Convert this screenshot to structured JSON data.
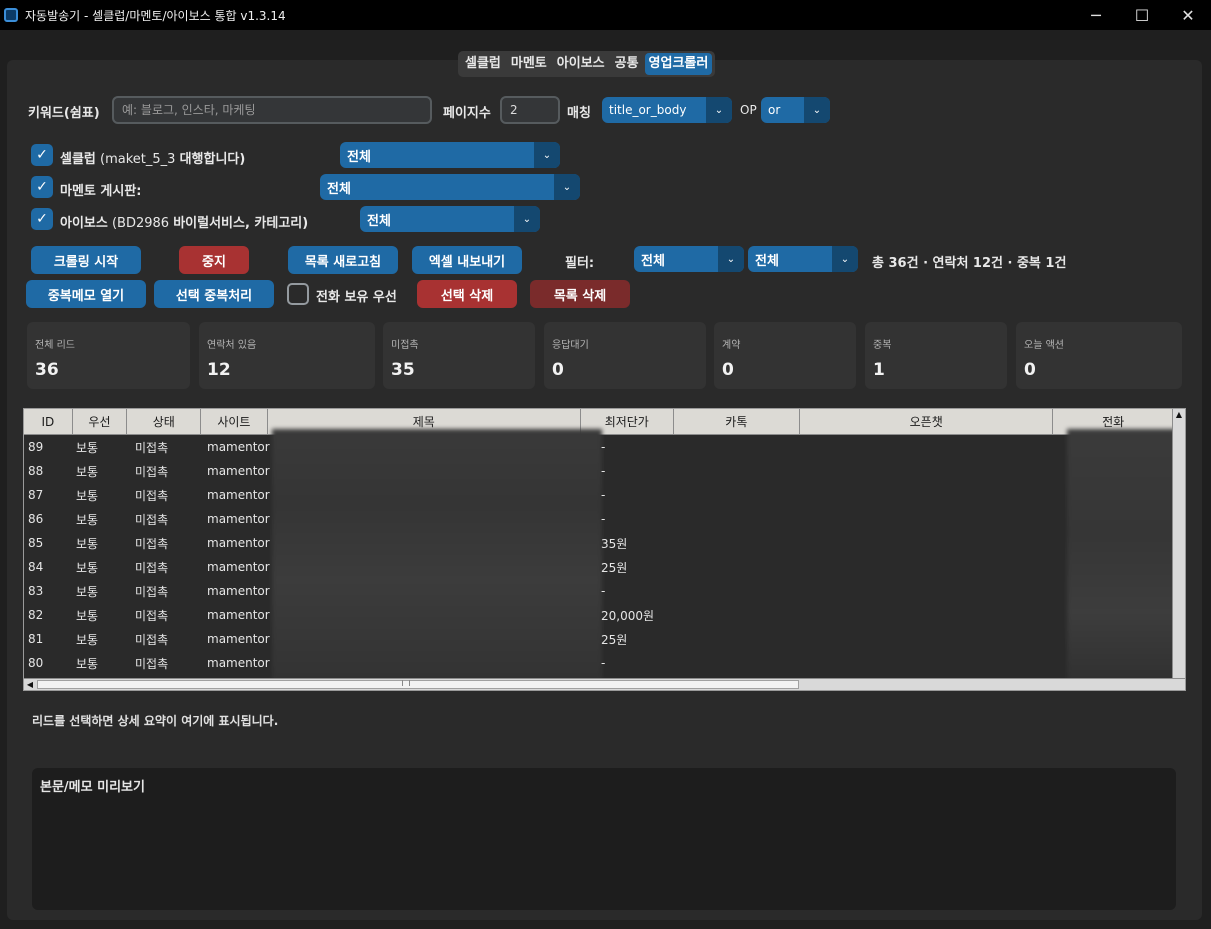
{
  "window": {
    "title": "자동발송기 - 셀클럽/마멘토/아이보스 통합 v1.3.14",
    "min": "─",
    "max": "☐",
    "close": "✕"
  },
  "tabs": [
    {
      "label": "셀클럽",
      "active": false
    },
    {
      "label": "마멘토",
      "active": false
    },
    {
      "label": "아이보스",
      "active": false
    },
    {
      "label": "공통",
      "active": false
    },
    {
      "label": "영업크롤러",
      "active": true
    }
  ],
  "search": {
    "keyword_label": "키워드(쉼표)",
    "keyword_placeholder": "예: 블로그, 인스타, 마케팅",
    "pages_label": "페이지수",
    "pages_value": "2",
    "match_label": "매칭",
    "match_value": "title_or_body",
    "op_label": "OP",
    "op_value": "or"
  },
  "sources": [
    {
      "checked": true,
      "name": "셀클럽",
      "detail": " (maket_5_3 ",
      "suffix": "대행합니다)",
      "filter": "전체"
    },
    {
      "checked": true,
      "name": "마멘토 게시판:",
      "detail": "",
      "suffix": "",
      "filter": "전체"
    },
    {
      "checked": true,
      "name": "아이보스",
      "detail": " (BD2986 ",
      "suffix": "바이럴서비스, 카테고리)",
      "filter": "전체"
    }
  ],
  "actions": {
    "start_crawl": "크롤링 시작",
    "stop": "중지",
    "refresh_list": "목록 새로고침",
    "export_excel": "엑셀 내보내기",
    "filter_label": "필터:",
    "filter1": "전체",
    "filter2": "전체",
    "totals": "총 36건 · 연락처 12건 · 중복 1건",
    "open_dup_memo": "중복메모 열기",
    "mark_dup": "선택 중복처리",
    "phone_priority": "전화 보유 우선",
    "delete_selected": "선택 삭제",
    "delete_list": "목록 삭제"
  },
  "stats": [
    {
      "label": "전체 리드",
      "value": "36"
    },
    {
      "label": "연락처 있음",
      "value": "12"
    },
    {
      "label": "미접촉",
      "value": "35"
    },
    {
      "label": "응답대기",
      "value": "0"
    },
    {
      "label": "계약",
      "value": "0"
    },
    {
      "label": "중복",
      "value": "1"
    },
    {
      "label": "오늘 액션",
      "value": "0"
    }
  ],
  "table": {
    "columns": [
      "ID",
      "우선",
      "상태",
      "사이트",
      "제목",
      "최저단가",
      "카톡",
      "오픈챗",
      "전화"
    ],
    "rows": [
      {
        "id": "89",
        "priority": "보통",
        "status": "미접촉",
        "site": "mamentor",
        "price": "-"
      },
      {
        "id": "88",
        "priority": "보통",
        "status": "미접촉",
        "site": "mamentor",
        "price": "-"
      },
      {
        "id": "87",
        "priority": "보통",
        "status": "미접촉",
        "site": "mamentor",
        "price": "-"
      },
      {
        "id": "86",
        "priority": "보통",
        "status": "미접촉",
        "site": "mamentor",
        "price": "-"
      },
      {
        "id": "85",
        "priority": "보통",
        "status": "미접촉",
        "site": "mamentor",
        "price": "35원"
      },
      {
        "id": "84",
        "priority": "보통",
        "status": "미접촉",
        "site": "mamentor",
        "price": "25원"
      },
      {
        "id": "83",
        "priority": "보통",
        "status": "미접촉",
        "site": "mamentor",
        "price": "-"
      },
      {
        "id": "82",
        "priority": "보통",
        "status": "미접촉",
        "site": "mamentor",
        "price": "20,000원"
      },
      {
        "id": "81",
        "priority": "보통",
        "status": "미접촉",
        "site": "mamentor",
        "price": "25원"
      },
      {
        "id": "80",
        "priority": "보통",
        "status": "미접촉",
        "site": "mamentor",
        "price": "-"
      }
    ]
  },
  "summary_hint": "리드를 선택하면 상세 요약이 여기에 표시됩니다.",
  "preview_title": "본문/메모 미리보기",
  "icons": {
    "check": "✓",
    "chevron": "⌄",
    "arrow_up": "▲",
    "arrow_left": "◀"
  }
}
